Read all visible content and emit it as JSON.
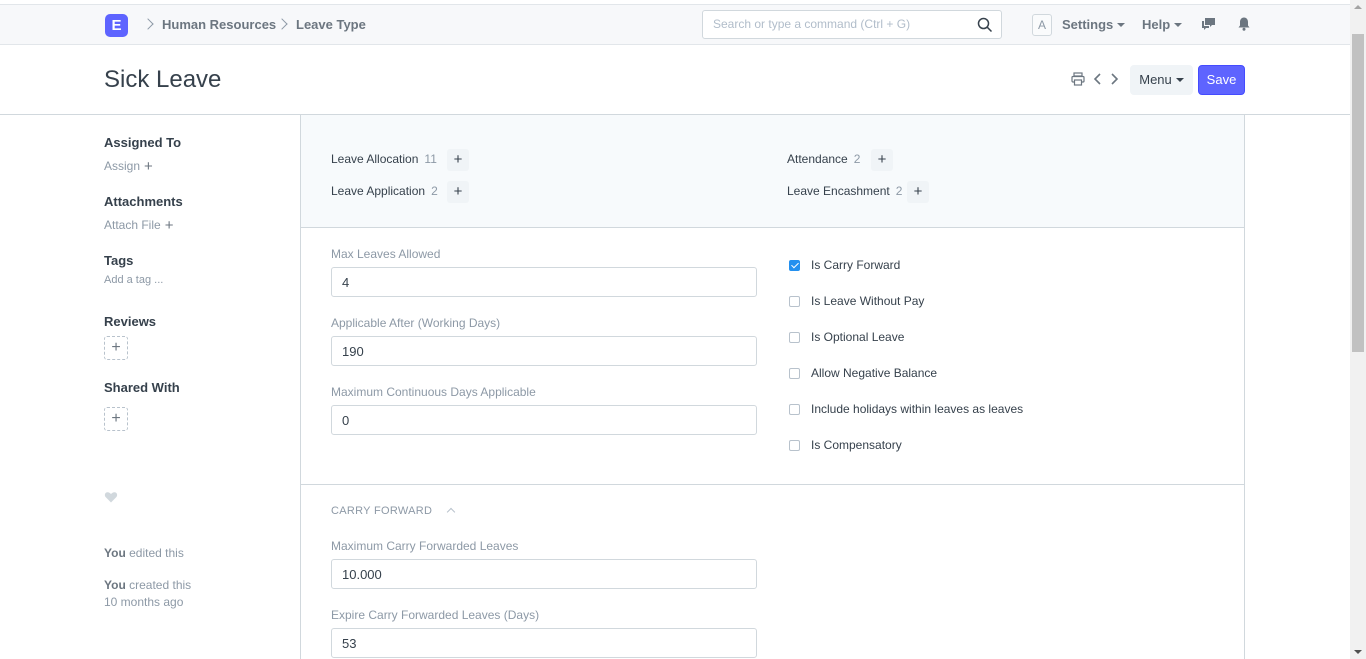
{
  "navbar": {
    "logo_letter": "E",
    "breadcrumbs": [
      "Human Resources",
      "Leave Type"
    ],
    "search_placeholder": "Search or type a command (Ctrl + G)",
    "avatar_letter": "A",
    "settings_label": "Settings",
    "help_label": "Help"
  },
  "page": {
    "title": "Sick Leave",
    "menu_label": "Menu",
    "save_label": "Save"
  },
  "sidebar": {
    "assigned_to_label": "Assigned To",
    "assign_link": "Assign",
    "attachments_label": "Attachments",
    "attach_link": "Attach File",
    "tags_label": "Tags",
    "add_tag_link": "Add a tag ...",
    "reviews_label": "Reviews",
    "shared_with_label": "Shared With",
    "edited_actor": "You",
    "edited_text": "edited this",
    "created_actor": "You",
    "created_text": "created this",
    "created_time": "10 months ago"
  },
  "dashboard": {
    "links": [
      {
        "label": "Leave Allocation",
        "count": "11"
      },
      {
        "label": "Leave Application",
        "count": "2"
      },
      {
        "label": "Attendance",
        "count": "2"
      },
      {
        "label": "Leave Encashment",
        "count": "2"
      }
    ]
  },
  "fields": {
    "max_leaves_label": "Max Leaves Allowed",
    "max_leaves_value": "4",
    "applicable_after_label": "Applicable After (Working Days)",
    "applicable_after_value": "190",
    "max_continuous_label": "Maximum Continuous Days Applicable",
    "max_continuous_value": "0"
  },
  "checkboxes": [
    {
      "label": "Is Carry Forward",
      "checked": true
    },
    {
      "label": "Is Leave Without Pay",
      "checked": false
    },
    {
      "label": "Is Optional Leave",
      "checked": false
    },
    {
      "label": "Allow Negative Balance",
      "checked": false
    },
    {
      "label": "Include holidays within leaves as leaves",
      "checked": false
    },
    {
      "label": "Is Compensatory",
      "checked": false
    }
  ],
  "carry_forward": {
    "section_title": "CARRY FORWARD",
    "max_cf_label": "Maximum Carry Forwarded Leaves",
    "max_cf_value": "10.000",
    "expire_label": "Expire Carry Forwarded Leaves (Days)",
    "expire_value": "53"
  },
  "colors": {
    "primary": "#5e64ff",
    "checkbox_checked": "#2490ef",
    "border": "#d1d8dd",
    "muted_text": "#8d99a6"
  }
}
